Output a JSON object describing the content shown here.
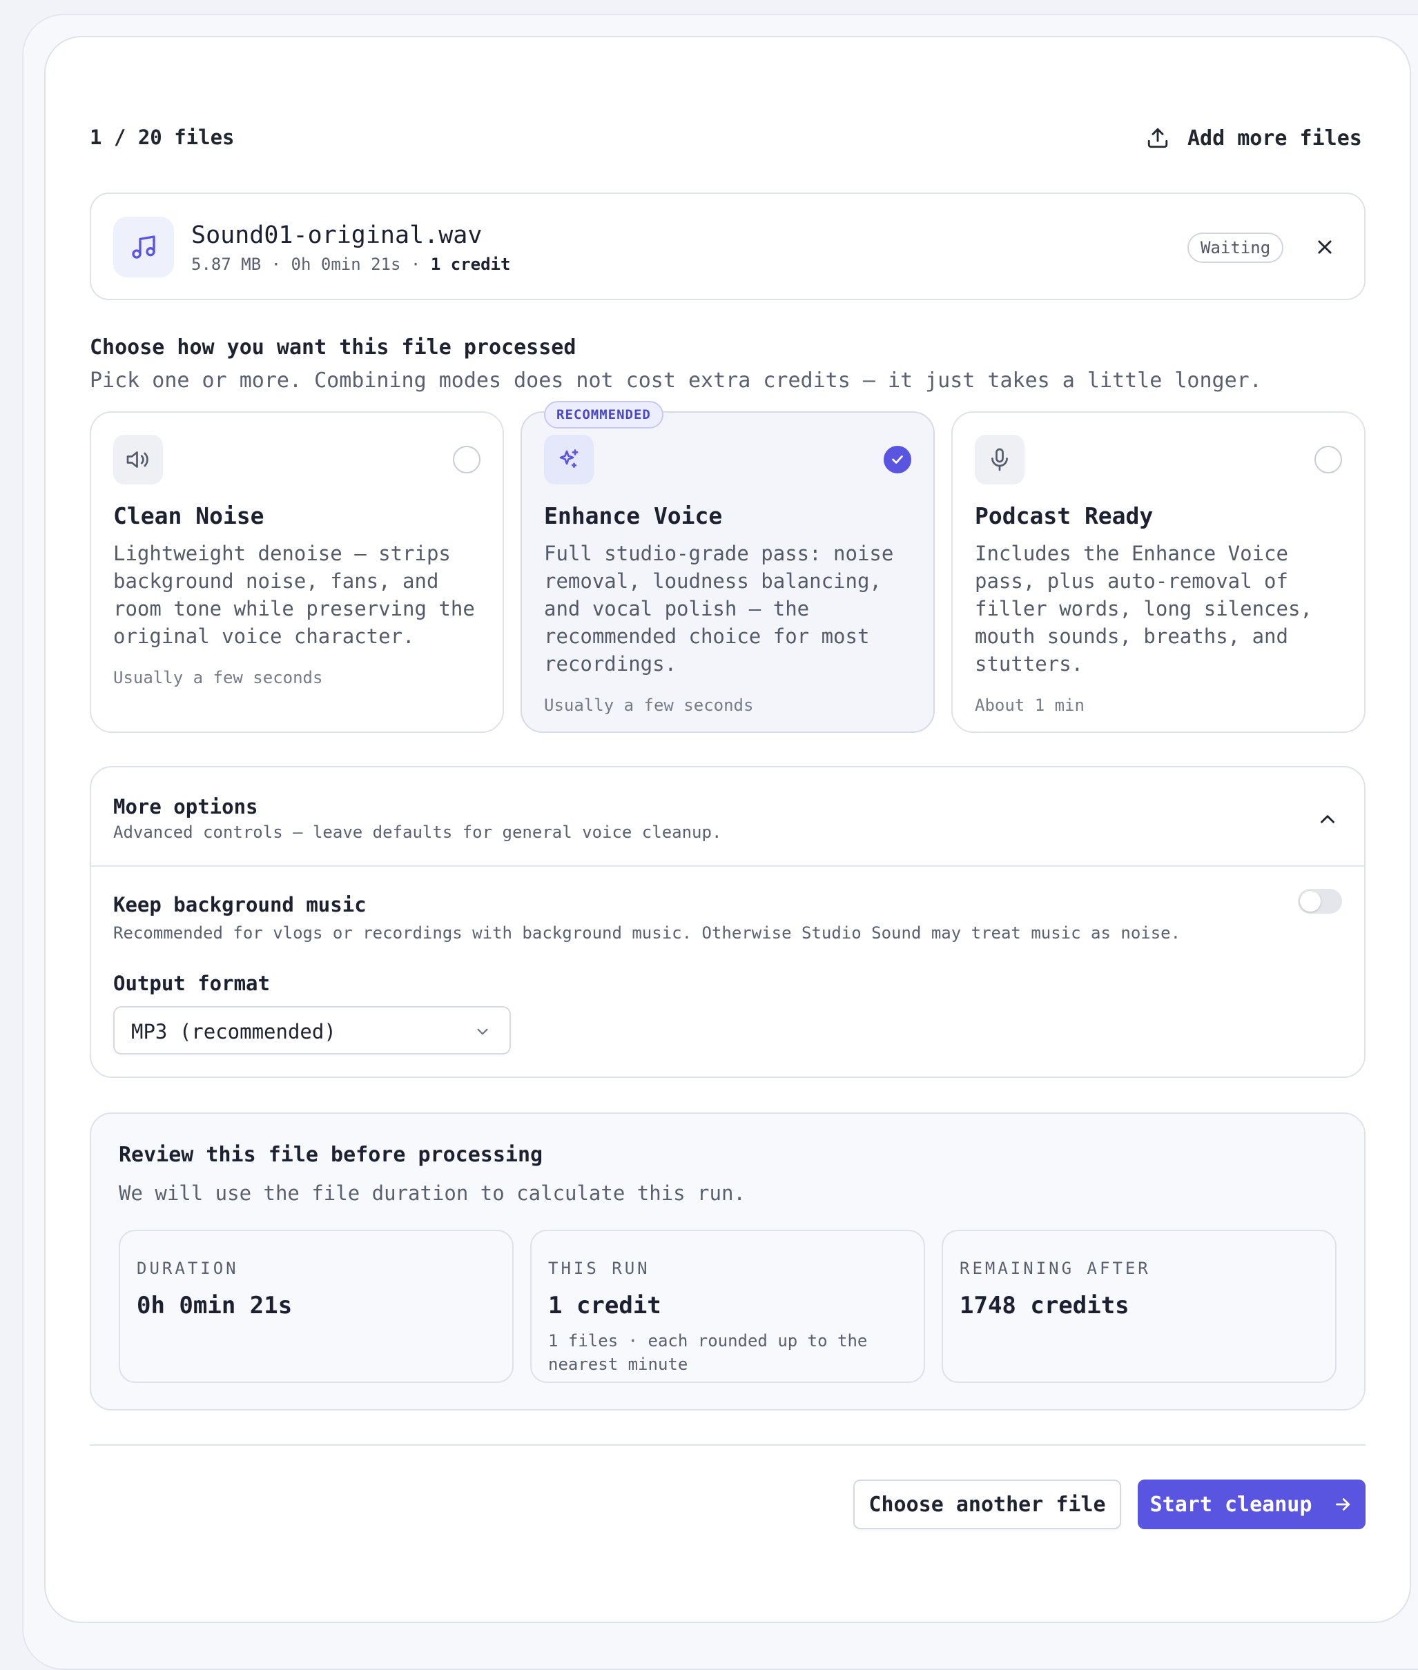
{
  "header": {
    "files_count": "1 / 20 files",
    "add_files_label": "Add more files"
  },
  "file": {
    "name": "Sound01-original.wav",
    "size": "5.87 MB",
    "duration": "0h 0min 21s",
    "cost": "1 credit",
    "separator": " · ",
    "status": "Waiting"
  },
  "choose": {
    "title": "Choose how you want this file processed",
    "subtitle": "Pick one or more. Combining modes does not cost extra credits — it just takes a little longer."
  },
  "modes": [
    {
      "title": "Clean Noise",
      "description": "Lightweight denoise — strips background noise, fans, and room tone while preserving the original voice character.",
      "time": "Usually a few seconds",
      "selected": false,
      "icon": "speaker-icon"
    },
    {
      "title": "Enhance Voice",
      "description": "Full studio-grade pass: noise removal, loudness balancing, and vocal polish — the recommended choice for most recordings.",
      "time": "Usually a few seconds",
      "selected": true,
      "badge": "RECOMMENDED",
      "icon": "sparkles-icon"
    },
    {
      "title": "Podcast Ready",
      "description": "Includes the Enhance Voice pass, plus auto-removal of filler words, long silences, mouth sounds, breaths, and stutters.",
      "time": "About 1 min",
      "selected": false,
      "icon": "microphone-icon"
    }
  ],
  "more_options": {
    "title": "More options",
    "subtitle": "Advanced controls — leave defaults for general voice cleanup.",
    "keep_music": {
      "title": "Keep background music",
      "subtitle": "Recommended for vlogs or recordings with background music. Otherwise Studio Sound may treat music as noise.",
      "enabled": false
    },
    "output_format": {
      "label": "Output format",
      "value": "MP3 (recommended)"
    }
  },
  "review": {
    "title": "Review this file before processing",
    "subtitle": "We will use the file duration to calculate this run.",
    "stats": [
      {
        "label": "DURATION",
        "value": "0h 0min 21s",
        "note": ""
      },
      {
        "label": "THIS RUN",
        "value": "1 credit",
        "note": "1 files · each rounded up to the nearest minute"
      },
      {
        "label": "REMAINING AFTER",
        "value": "1748 credits",
        "note": ""
      }
    ]
  },
  "actions": {
    "secondary": "Choose another file",
    "primary": "Start cleanup"
  },
  "colors": {
    "accent": "#5a55e0",
    "accent_soft": "#eceefd",
    "text": "#1c2030",
    "muted": "#5b6070",
    "border": "#dfe2ea"
  }
}
